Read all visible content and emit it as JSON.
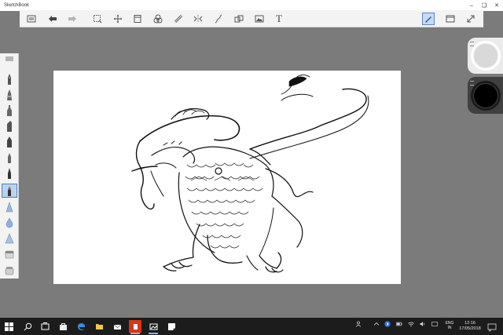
{
  "window": {
    "title": "SketchBook",
    "controls": [
      "minimize-icon",
      "restore-icon",
      "close-icon"
    ]
  },
  "toolbar": {
    "items": [
      "lagoon-icon",
      "undo-icon",
      "redo-icon",
      "select-icon",
      "transform-icon",
      "crop-icon",
      "color-editor-icon",
      "ruler-icon",
      "symmetry-icon",
      "curve-icon",
      "layers-icon",
      "add-image-icon",
      "text-icon",
      "brush-toggle-icon",
      "layout-icon",
      "fullscreen-icon"
    ],
    "active": "brush-toggle-icon",
    "text_tool_label": "T"
  },
  "brush_palette": {
    "items": [
      "pencil",
      "ballpoint-pen",
      "technical-pen",
      "marker",
      "chisel-marker",
      "felt-pen",
      "fine-liner",
      "inking-pen",
      "airbrush",
      "soft-eraser",
      "hard-eraser",
      "smear",
      "blend"
    ],
    "active": "inking-pen"
  },
  "color_pucks": {
    "light": "#d9d9d9",
    "dark": "#000000"
  },
  "taskbar": {
    "apps": [
      "start",
      "search",
      "task-view",
      "store",
      "edge",
      "file-explorer",
      "mail",
      "office",
      "photos",
      "sticky-notes"
    ],
    "running": "office",
    "lang_line1": "ENG",
    "lang_line2": "IN",
    "time": "12:16",
    "date": "17/05/2018"
  },
  "colors": {
    "workspace": "#7b7b7b",
    "taskbar": "#1c1c1c",
    "accent": "#4f7fc0"
  }
}
